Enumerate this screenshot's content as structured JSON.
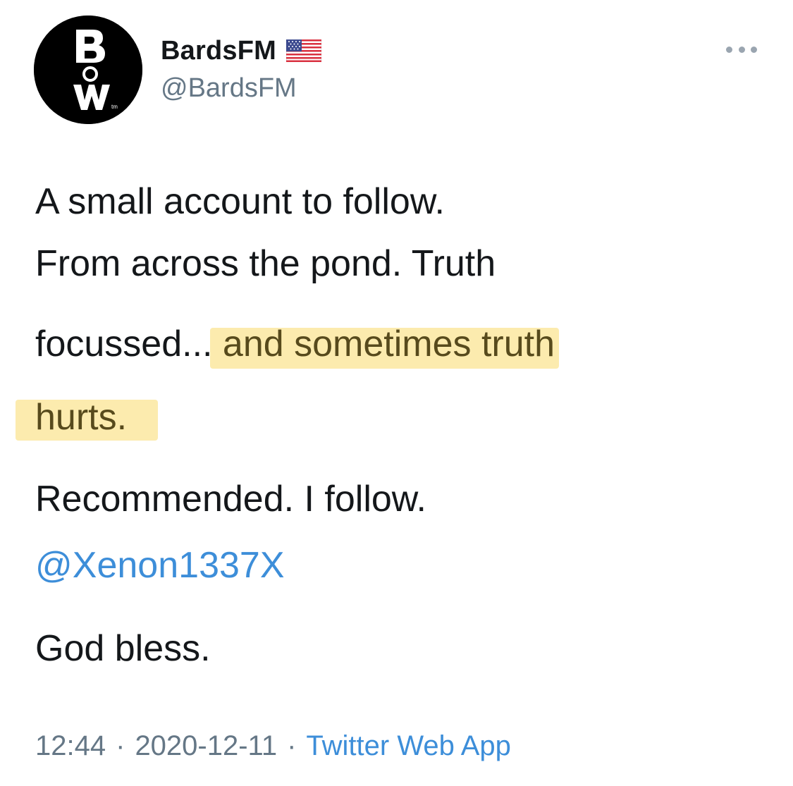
{
  "author": {
    "display_name": "BardsFM",
    "handle": "@BardsFM",
    "flag_icon": "us-flag-icon",
    "avatar_text": "B O W",
    "avatar_tm": "tm"
  },
  "menu": {
    "icon": "more-dots-icon"
  },
  "tweet": {
    "line1": "A small account to follow.",
    "line2": "From across the pond. Truth",
    "line3_plain": "focussed... ",
    "line3_highlight": "and sometimes truth",
    "line4_highlight": "hurts.",
    "line5": "Recommended. I follow.",
    "mention": "@Xenon1337X",
    "line6": "God bless.",
    "highlight_color": "#fbe7a0"
  },
  "meta": {
    "time": "12:44",
    "date": "2020-12-11",
    "separator": "·",
    "source": "Twitter Web App"
  },
  "colors": {
    "link": "#3d8ed9",
    "secondary": "#657786",
    "text": "#14171a"
  }
}
